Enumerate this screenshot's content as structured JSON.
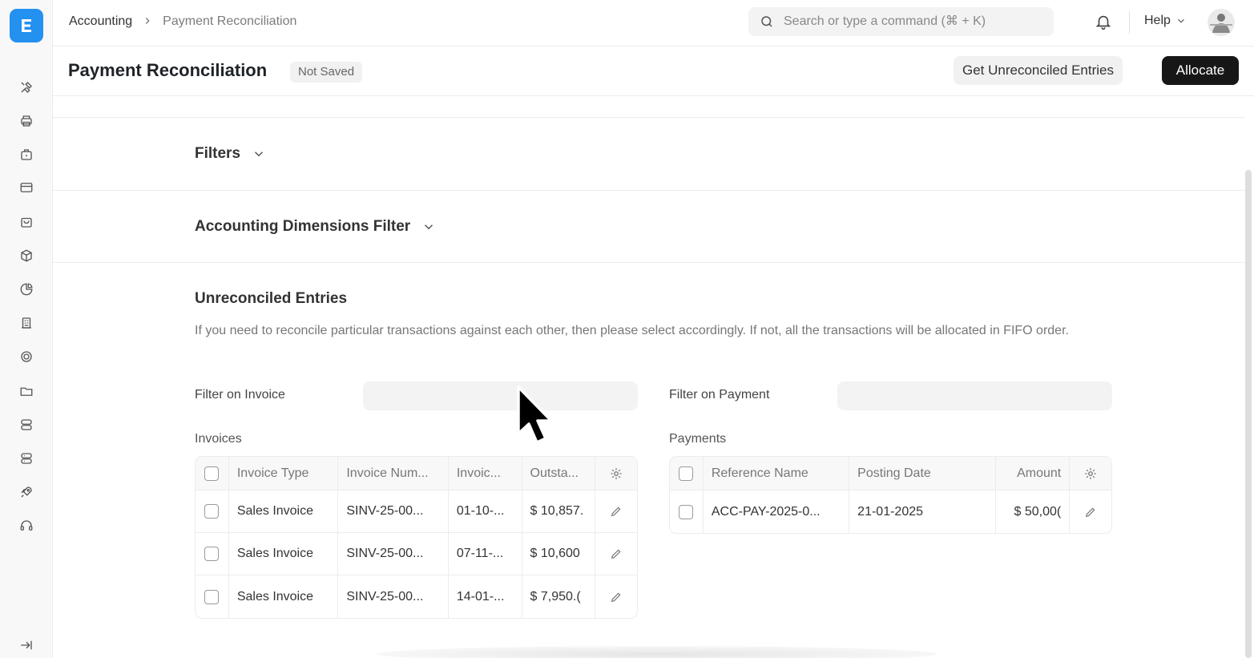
{
  "app": {
    "logo_letter": "E"
  },
  "sidebar": {
    "icons": [
      "tools-icon",
      "printer-icon",
      "briefcase-icon",
      "credit-card-icon",
      "shopping-bag-icon",
      "box-icon",
      "chart-pie-icon",
      "building-icon",
      "shield-icon",
      "folder-icon",
      "database-icon",
      "server-icon",
      "rocket-icon",
      "headset-icon"
    ],
    "collapse_icon": "collapse-sidebar-icon"
  },
  "topbar": {
    "breadcrumb": [
      "Accounting",
      "Payment Reconciliation"
    ],
    "search_placeholder": "Search or type a command (⌘ + K)",
    "help_label": "Help"
  },
  "page": {
    "title": "Payment Reconciliation",
    "status": "Not Saved",
    "actions": {
      "secondary": "Get Unreconciled Entries",
      "primary": "Allocate"
    }
  },
  "sections": {
    "filters": "Filters",
    "accounting_dimensions": "Accounting Dimensions Filter",
    "unreconciled": {
      "title": "Unreconciled Entries",
      "description": "If you need to reconcile particular transactions against each other, then please select accordingly. If not, all the transactions will be allocated in FIFO order.",
      "filter_invoice_label": "Filter on Invoice",
      "filter_payment_label": "Filter on Payment",
      "invoices_label": "Invoices",
      "payments_label": "Payments"
    }
  },
  "invoices": {
    "columns": [
      "Invoice Type",
      "Invoice Num...",
      "Invoic...",
      "Outsta..."
    ],
    "rows": [
      {
        "type": "Sales Invoice",
        "number": "SINV-25-00...",
        "date": "01-10-...",
        "outstanding": "$ 10,857."
      },
      {
        "type": "Sales Invoice",
        "number": "SINV-25-00...",
        "date": "07-11-...",
        "outstanding": "$ 10,600"
      },
      {
        "type": "Sales Invoice",
        "number": "SINV-25-00...",
        "date": "14-01-...",
        "outstanding": "$ 7,950.("
      }
    ]
  },
  "payments": {
    "columns": [
      "Reference Name",
      "Posting Date",
      "Amount"
    ],
    "rows": [
      {
        "reference": "ACC-PAY-2025-0...",
        "posting_date": "21-01-2025",
        "amount": "$ 50,00("
      }
    ]
  },
  "colors": {
    "brand": "#2490ef",
    "primary_button": "#171717"
  }
}
